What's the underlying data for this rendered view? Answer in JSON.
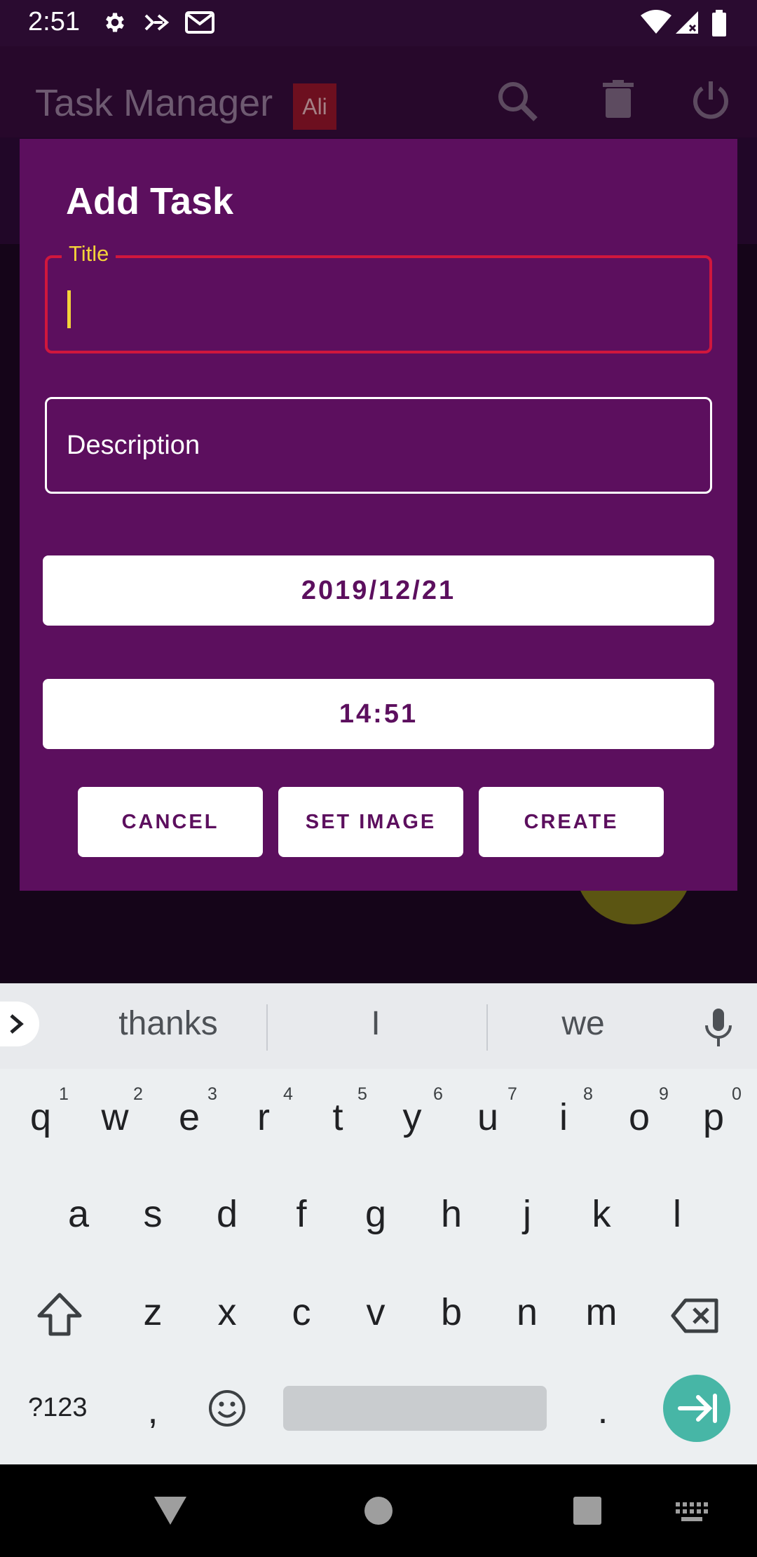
{
  "status_bar": {
    "time": "2:51"
  },
  "app_bar": {
    "title": "Task Manager",
    "badge": "Ali"
  },
  "dialog": {
    "title": "Add Task",
    "title_field_label": "Title",
    "title_field_value": "",
    "description_placeholder": "Description",
    "date": "2019/12/21",
    "time": "14:51",
    "buttons": {
      "cancel": "CANCEL",
      "set_image": "SET IMAGE",
      "create": "CREATE"
    }
  },
  "keyboard": {
    "suggestions": [
      "thanks",
      "I",
      "we"
    ],
    "row1": [
      "q",
      "w",
      "e",
      "r",
      "t",
      "y",
      "u",
      "i",
      "o",
      "p"
    ],
    "row1_hints": [
      "1",
      "2",
      "3",
      "4",
      "5",
      "6",
      "7",
      "8",
      "9",
      "0"
    ],
    "row2": [
      "a",
      "s",
      "d",
      "f",
      "g",
      "h",
      "j",
      "k",
      "l"
    ],
    "row3": [
      "z",
      "x",
      "c",
      "v",
      "b",
      "n",
      "m"
    ],
    "symbols_key": "?123",
    "comma": ",",
    "period": "."
  },
  "colors": {
    "dialog_bg": "#5c0f5e",
    "title_border": "#d0173d",
    "label_yellow": "#f3d23a",
    "enter_key": "#47b6a6"
  }
}
